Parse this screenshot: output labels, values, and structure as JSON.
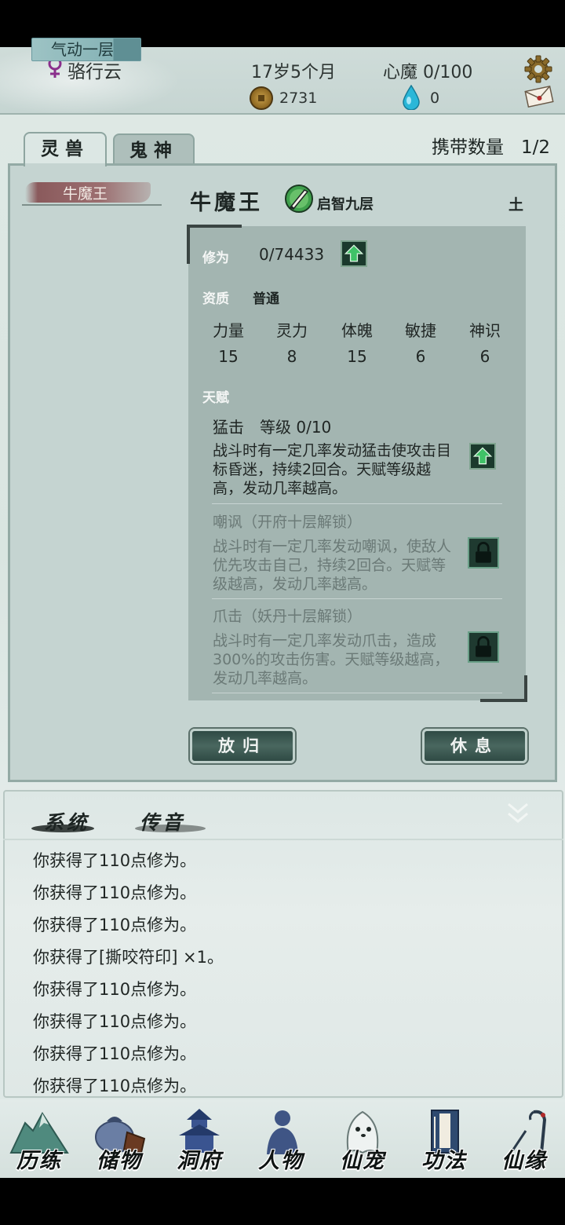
{
  "header": {
    "player_name": "骆行云",
    "realm": "气动一层",
    "age": "17岁5个月",
    "heart_demon": "心魔 0/100",
    "coins": "2731",
    "gems": "0",
    "icons": [
      "female-icon",
      "coin-icon",
      "gem-icon",
      "settings-icon",
      "mail-icon"
    ]
  },
  "tabs": {
    "lingshou": "灵兽",
    "guishen": "鬼神",
    "active": "lingshou"
  },
  "carry": {
    "label": "携带数量",
    "value": "1/2"
  },
  "pet_list": [
    {
      "name": "牛魔王"
    }
  ],
  "pet": {
    "name": "牛魔王",
    "level": "启智九层",
    "element": "土",
    "cultivation_label": "修为",
    "cultivation_value": "0/74433",
    "aptitude_label": "资质",
    "aptitude_value": "普通",
    "stats": [
      {
        "name": "力量",
        "value": "15"
      },
      {
        "name": "灵力",
        "value": "8"
      },
      {
        "name": "体魄",
        "value": "15"
      },
      {
        "name": "敏捷",
        "value": "6"
      },
      {
        "name": "神识",
        "value": "6"
      }
    ],
    "talent_label": "天赋",
    "talents": [
      {
        "title": "猛击　等级  0/10",
        "desc": "战斗时有一定几率发动猛击使攻击目标昏迷，持续2回合。天赋等级越高，发动几率越高。",
        "locked": false
      },
      {
        "title": "嘲讽（开府十层解锁）",
        "desc": "战斗时有一定几率发动嘲讽，使敌人优先攻击自己，持续2回合。天赋等级越高，发动几率越高。",
        "locked": true
      },
      {
        "title": "爪击（妖丹十层解锁）",
        "desc": "战斗时有一定几率发动爪击，造成300%的攻击伤害。天赋等级越高，发动几率越高。",
        "locked": true
      }
    ]
  },
  "actions": {
    "release": "放归",
    "rest": "休息"
  },
  "log": {
    "tab_system": "系统",
    "tab_message": "传音",
    "lines": [
      "你获得了110点修为。",
      "你获得了110点修为。",
      "你获得了110点修为。",
      "你获得了[撕咬符印] ×1。",
      "你获得了110点修为。",
      "你获得了110点修为。",
      "你获得了110点修为。",
      "你获得了110点修为。"
    ]
  },
  "nav": [
    {
      "label": "历练",
      "icon": "mountain-icon"
    },
    {
      "label": "储物",
      "icon": "bag-icon"
    },
    {
      "label": "洞府",
      "icon": "pagoda-icon"
    },
    {
      "label": "人物",
      "icon": "person-icon"
    },
    {
      "label": "仙宠",
      "icon": "ghost-pet-icon"
    },
    {
      "label": "功法",
      "icon": "book-icon"
    },
    {
      "label": "仙缘",
      "icon": "crane-icon"
    }
  ],
  "colors": {
    "panel_bg": "#c5d4d1",
    "detail_bg": "#a3b5b1",
    "button_dark": "#2f4a44",
    "upgrade_green": "#2fae5a"
  }
}
